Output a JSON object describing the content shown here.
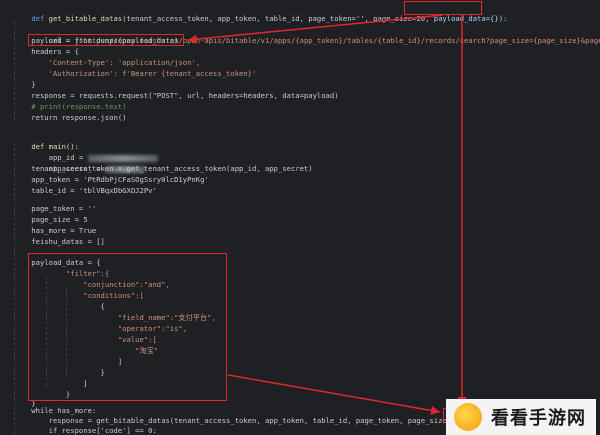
{
  "code": {
    "l1": {
      "kw": "def ",
      "fn": "get_bitable_datas",
      "rest": "(tenant_access_token, app_token, table_id, page_token='', page_size=20, ",
      "hl": "payload_data={}",
      "end": "):"
    },
    "l2": {
      "indent": "    ",
      "a": "url = f",
      "str": "\"https://open.feishu.cn/open-apis/bitable/v1/apps/{app_token}/tables/{table_id}/records/search?page_size={page_size}&page_token={page_token}\""
    },
    "l3": "    payload = json.dumps(payload_data)",
    "l4": "    headers = {",
    "l5": "        'Content-Type': 'application/json',",
    "l6": "        'Authorization': f'Bearer {tenant_access_token}'",
    "l7": "    }",
    "l8": "    response = requests.request(\"POST\", url, headers=headers, data=payload)",
    "l9": "    # print(response.text)",
    "l10": "    return response.json()",
    "l11": "def main():",
    "l12": "    app_id = ",
    "l13": "    app_secret = ",
    "l14": "    tenant_access_token = get_tenant_access_token(app_id, app_secret)",
    "l15": "    app_token = 'PtRdbPjCFaSOgSsry0lcD1yPnKg'",
    "l16": "    table_id = 'tblVBqxDbGXOJ2Pv'",
    "l17": "    page_token = ''",
    "l18": "    page_size = 5",
    "l19": "    has_more = True",
    "l20": "    feishu_datas = []",
    "l21": "    payload_data = {",
    "l22": "            \"filter\":{",
    "l23": "                \"conjunction\":\"and\",",
    "l24": "                \"conditions\":[",
    "l25": "                    {",
    "l26": "                        \"field_name\":\"支付平台\",",
    "l27": "                        \"operator\":\"is\",",
    "l28": "                        \"value\":[",
    "l29": "                            \"淘宝\"",
    "l30": "                        ]",
    "l31": "                    }",
    "l32": "                ]",
    "l33": "            }",
    "l34": "    }",
    "l35": "    while has_more:",
    "l36": "        response = get_bitable_datas(tenant_access_token, app_token, table_id, page_token, page_size, payload_data)",
    "l37": "        if response['code'] == 0:"
  },
  "watermark": {
    "text": "看看手游网"
  },
  "colors": {
    "annotation": "#e0282b",
    "background": "#1f2023"
  }
}
